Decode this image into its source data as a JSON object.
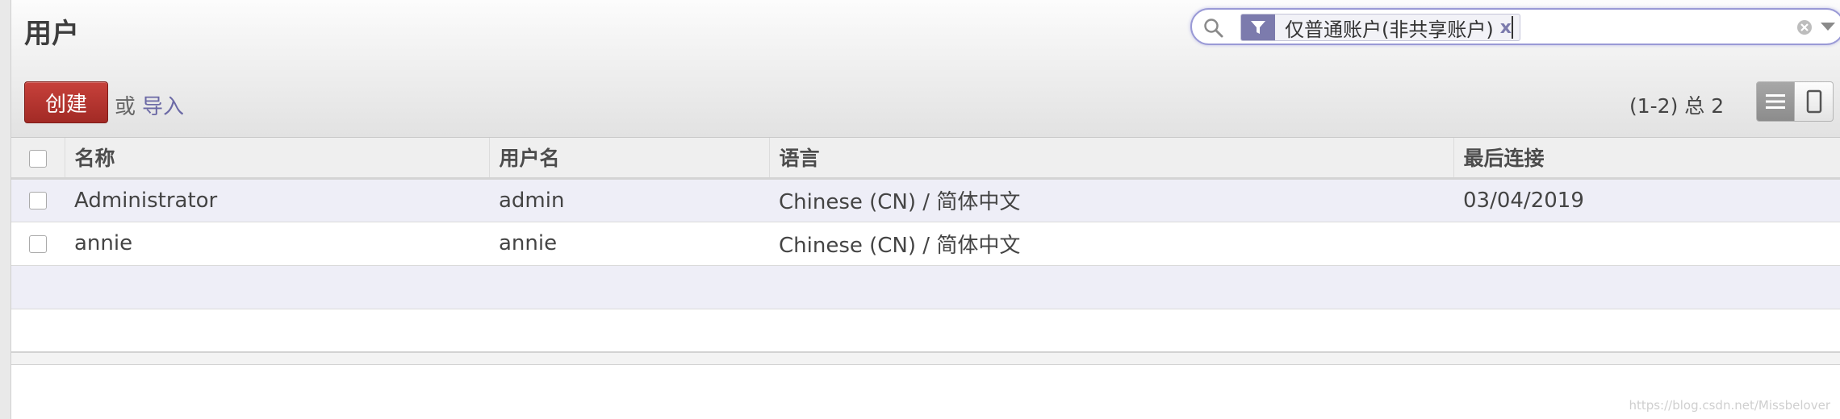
{
  "page": {
    "title": "用户"
  },
  "search": {
    "facet_value": "仅普通账户(非共享账户)",
    "facet_remove": "x",
    "query": ""
  },
  "toolbar": {
    "create_label": "创建",
    "or_label": "或",
    "import_label": "导入"
  },
  "pager": {
    "text": "(1-2) 总 2"
  },
  "table": {
    "headers": {
      "name": "名称",
      "login": "用户名",
      "lang": "语言",
      "last_login": "最后连接"
    },
    "rows": [
      {
        "name": "Administrator",
        "login": "admin",
        "lang": "Chinese (CN) / 简体中文",
        "last_login": "03/04/2019"
      },
      {
        "name": "annie",
        "login": "annie",
        "lang": "Chinese (CN) / 简体中文",
        "last_login": ""
      }
    ]
  },
  "watermark": "https://blog.csdn.net/Missbelover",
  "colors": {
    "accent": "#7c7bad",
    "create_button": "#b3332e",
    "odd_row": "#eeeef7"
  }
}
